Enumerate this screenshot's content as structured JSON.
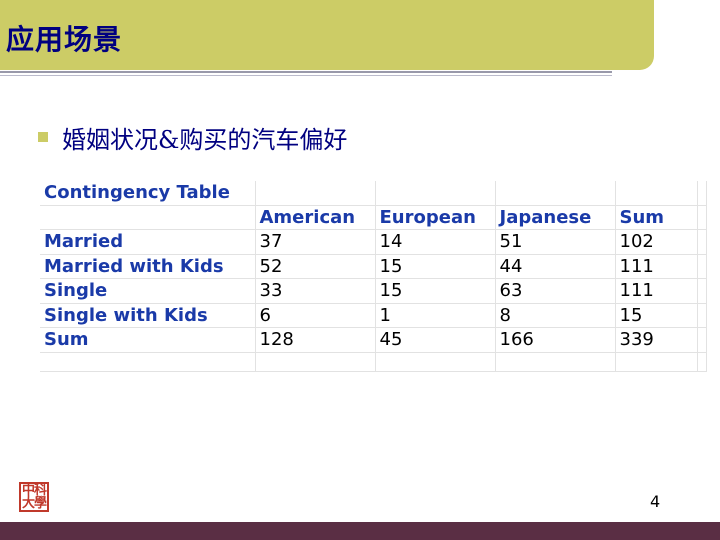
{
  "slide": {
    "title": "应用场景",
    "bullet": "婚姻状况&购买的汽车偏好",
    "page_number": "4"
  },
  "logo": {
    "glyphs": [
      "中",
      "科",
      "大",
      "學"
    ]
  },
  "table": {
    "title": "Contingency Table",
    "columns": [
      "American",
      "European",
      "Japanese",
      "Sum"
    ],
    "rows": [
      {
        "label": "Married",
        "values": [
          "37",
          "14",
          "51",
          "102"
        ]
      },
      {
        "label": "Married with Kids",
        "values": [
          "52",
          "15",
          "44",
          "111"
        ]
      },
      {
        "label": "Single",
        "values": [
          "33",
          "15",
          "63",
          "111"
        ]
      },
      {
        "label": "Single with Kids",
        "values": [
          "6",
          "1",
          "8",
          "15"
        ]
      },
      {
        "label": "Sum",
        "values": [
          "128",
          "45",
          "166",
          "339"
        ]
      }
    ]
  },
  "colors": {
    "title_bar": "#cccc66",
    "title_text": "#000080",
    "table_header": "#1a3aa8",
    "footer_bar": "#5a2e44"
  }
}
